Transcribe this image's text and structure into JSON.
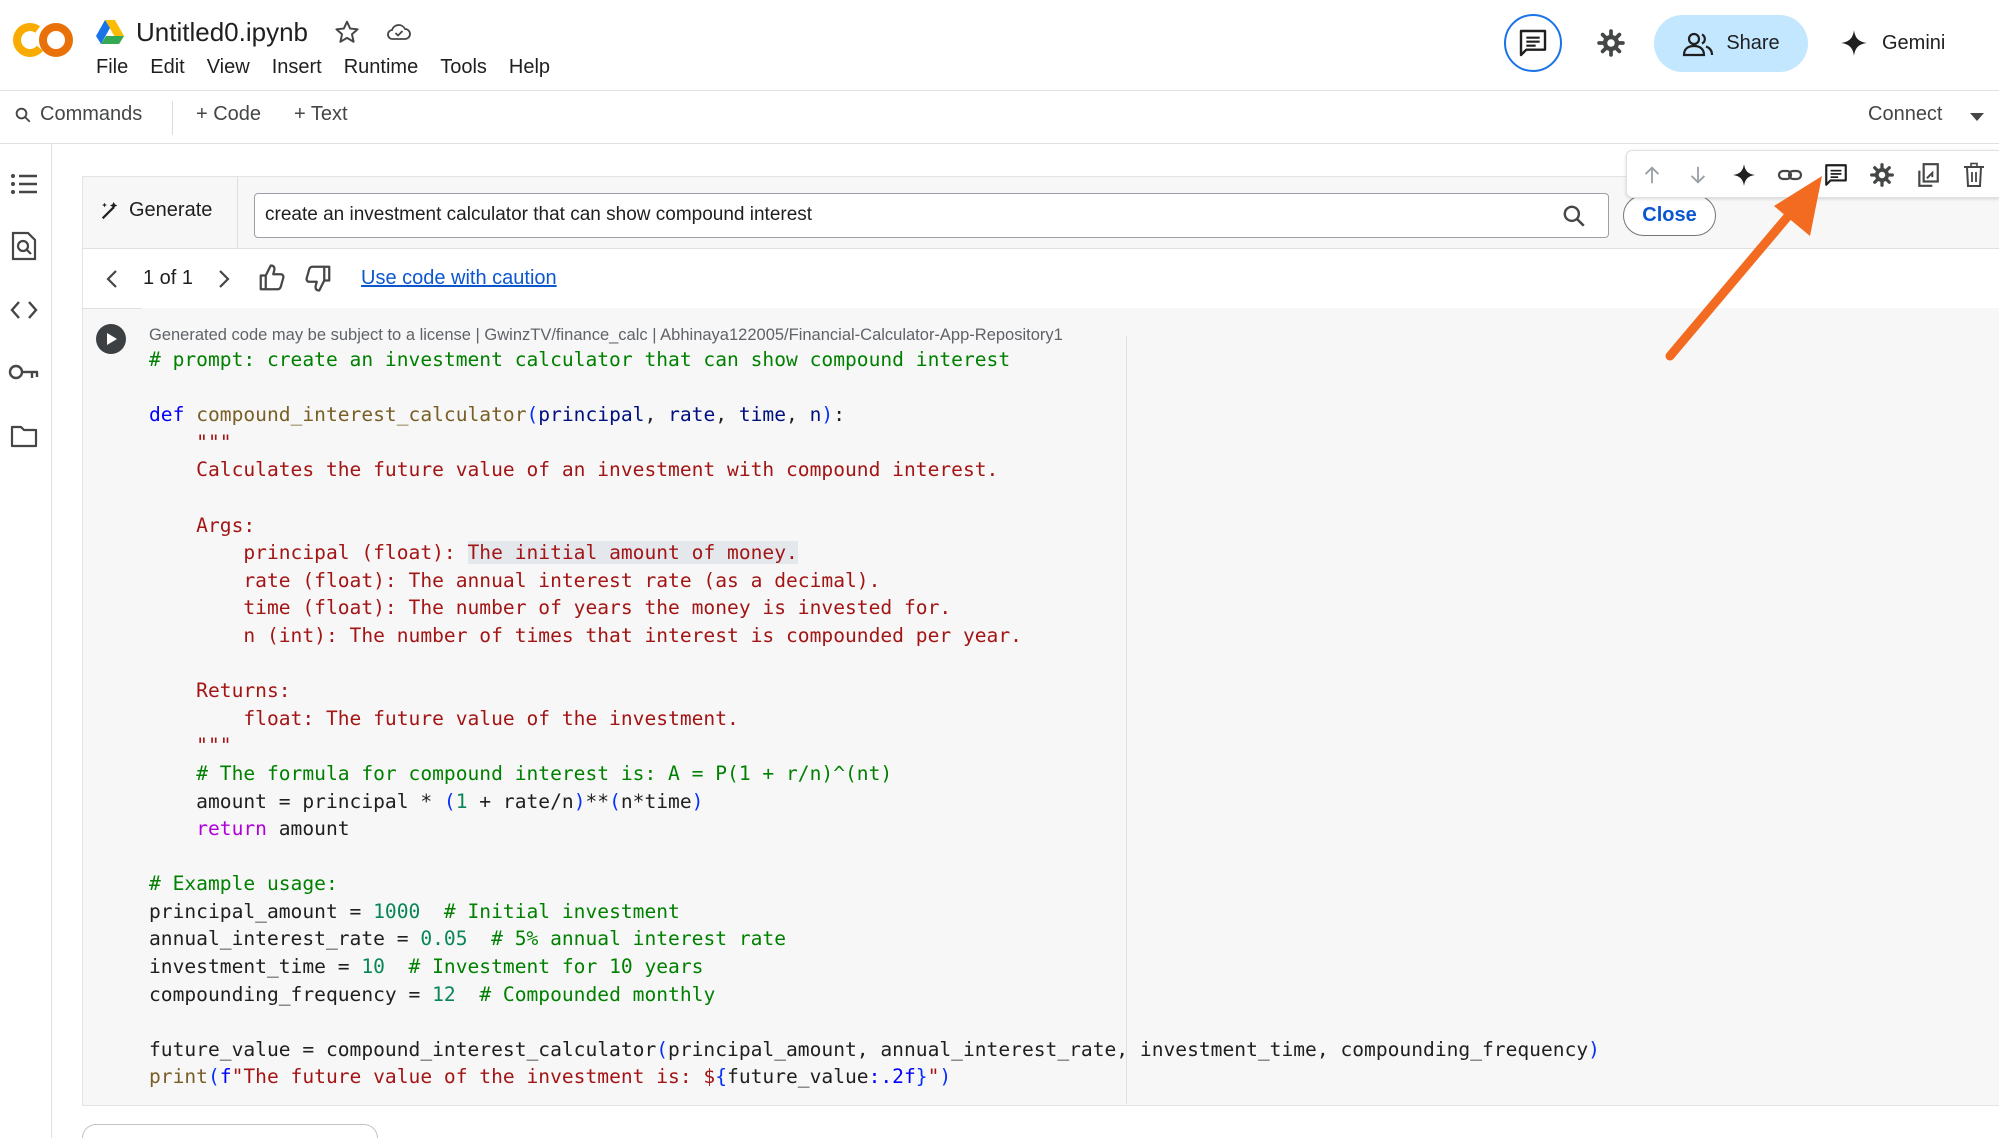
{
  "header": {
    "logo_text": "CO",
    "title": "Untitled0.ipynb",
    "menu": [
      "File",
      "Edit",
      "View",
      "Insert",
      "Runtime",
      "Tools",
      "Help"
    ],
    "share_label": "Share",
    "gemini_label": "Gemini"
  },
  "toolbar": {
    "commands_label": "Commands",
    "code_label": "+ Code",
    "text_label": "+ Text",
    "connect_label": "Connect"
  },
  "generate": {
    "label": "Generate",
    "prompt_value": "create an investment calculator that can show compound interest",
    "close_label": "Close"
  },
  "navigation": {
    "count": "1 of 1",
    "caution_link": "Use code with caution"
  },
  "cell": {
    "license_text": "Generated code may be subject to a license | GwinzTV/finance_calc | Abhinaya122005/Financial-Calculator-App-Repository1"
  },
  "colors": {
    "accent_blue": "#1a73e8",
    "share_bg": "#c2e7ff",
    "arrow_orange": "#f26b21",
    "logo_orange": "#f9ab00"
  },
  "icons": {
    "rail": [
      "table-of-contents-icon",
      "find-replace-icon",
      "code-snippets-icon",
      "secrets-key-icon",
      "files-folder-icon"
    ],
    "cell_toolbar": [
      "move-up-icon",
      "move-down-icon",
      "gemini-spark-icon",
      "link-icon",
      "comment-icon",
      "settings-gear-icon",
      "mirror-cell-icon",
      "delete-trash-icon"
    ]
  }
}
